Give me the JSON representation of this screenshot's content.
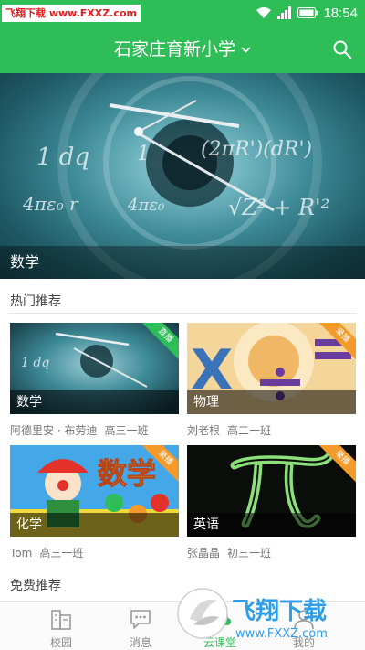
{
  "status_bar": {
    "watermark": "飞翔下载 www.FXXZ.com",
    "time": "18:54"
  },
  "header": {
    "title": "石家庄育新小学"
  },
  "banner": {
    "caption": "数学"
  },
  "hot": {
    "title": "热门推荐",
    "cards": [
      {
        "subject": "数学",
        "ribbon": "直播",
        "teacher": "阿德里安 · 布劳迪",
        "class": "高三一班"
      },
      {
        "subject": "物理",
        "ribbon": "录播",
        "teacher": "刘老根",
        "class": "高二一班"
      },
      {
        "subject": "化学",
        "ribbon": "录播",
        "teacher": "Tom",
        "class": "高三一班"
      },
      {
        "subject": "英语",
        "ribbon": "录播",
        "teacher": "张晶晶",
        "class": "初三一班"
      }
    ]
  },
  "free": {
    "title": "免费推荐"
  },
  "nav": [
    {
      "label": "校园",
      "active": false
    },
    {
      "label": "消息",
      "active": false
    },
    {
      "label": "云课堂",
      "active": true
    },
    {
      "label": "我的",
      "active": false
    }
  ],
  "colors": {
    "primary": "#2fbd58",
    "ribbon_live": "#2fbd58",
    "ribbon_recorded": "#f39a2b"
  },
  "watermark_bottom": {
    "brand": "飞翔下载",
    "url": "www.FXXZ.com"
  }
}
